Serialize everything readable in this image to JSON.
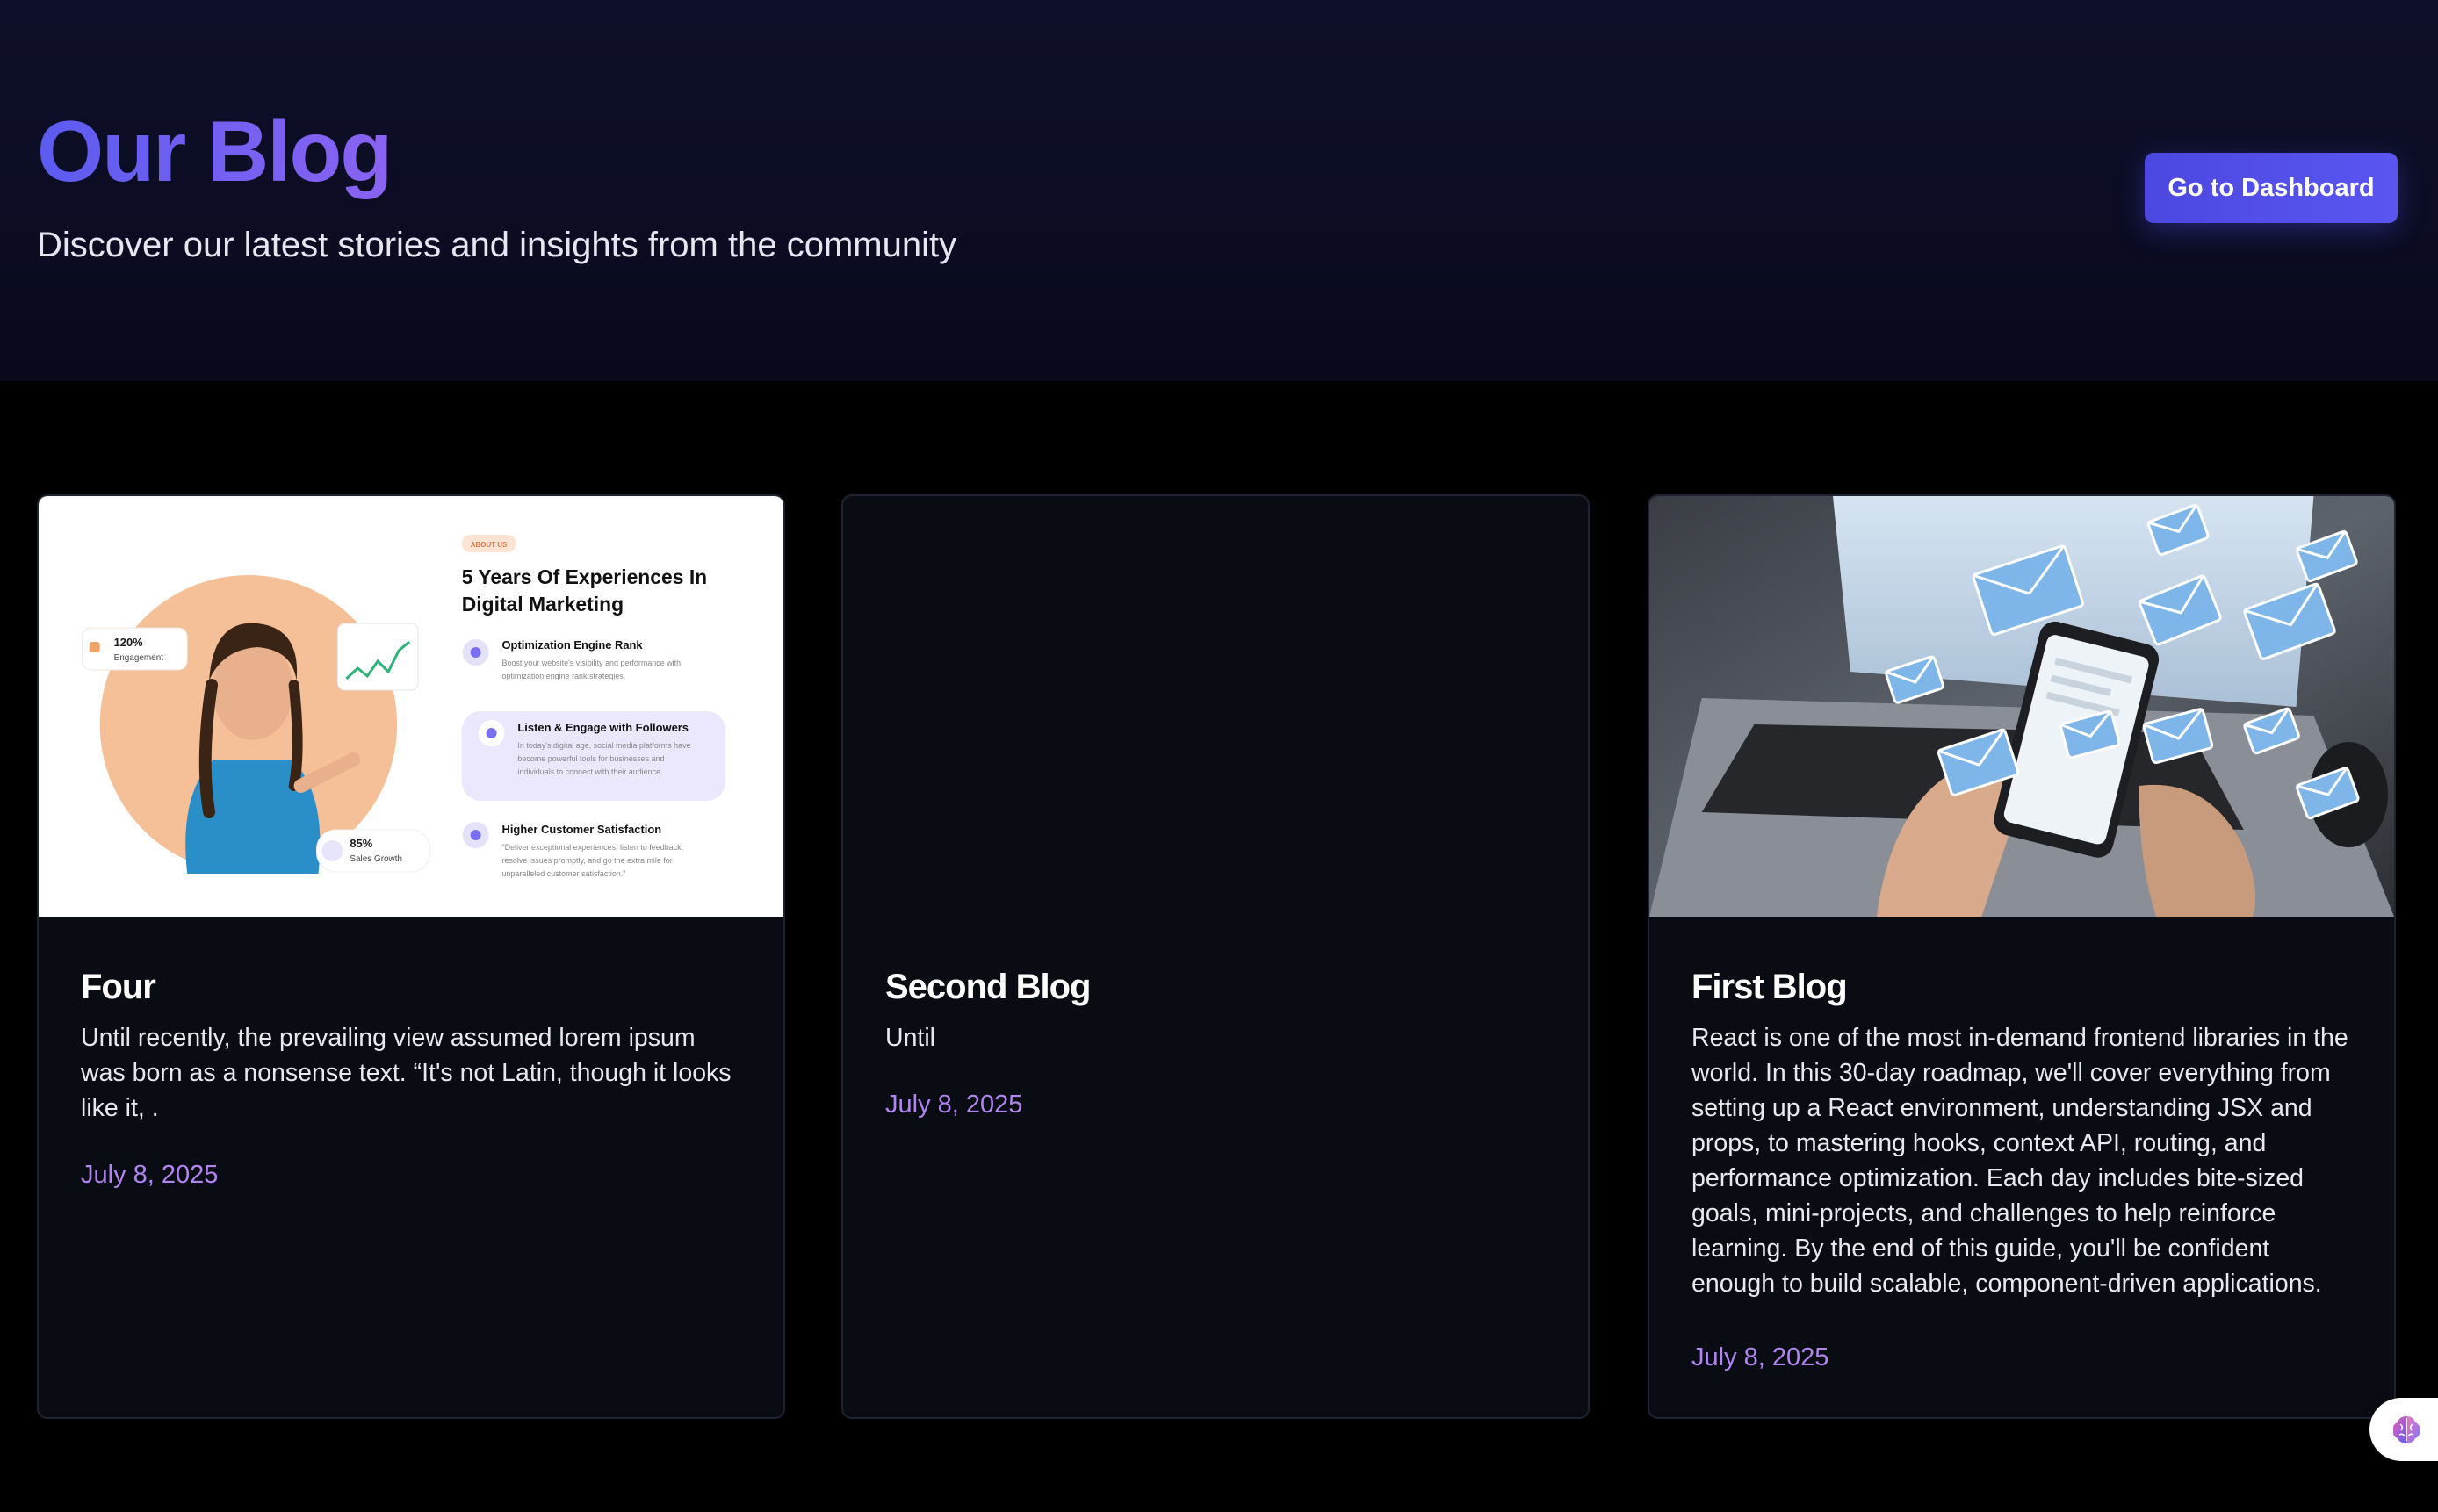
{
  "header": {
    "title": "Our Blog",
    "subtitle": "Discover our latest stories and insights from the community",
    "dashboard_button": "Go to Dashboard"
  },
  "posts": [
    {
      "title": "Four",
      "excerpt": "Until recently, the prevailing view assumed lorem ipsum was born as a nonsense text. “It's not Latin, though it looks like it, .",
      "date": "July 8, 2025",
      "image": {
        "kind": "marketing-banner",
        "tag": "ABOUT US",
        "heading_line1": "5 Years Of Experiences In",
        "heading_line2": "Digital Marketing",
        "engagement_value": "120%",
        "engagement_label": "Engagement",
        "sales_value": "85%",
        "sales_label": "Sales Growth",
        "features": [
          {
            "title": "Optimization Engine Rank",
            "desc_line1": "Boost your website's visibility and performance with",
            "desc_line2": "optimization engine rank strategies.",
            "desc_line3": ""
          },
          {
            "title": "Listen & Engage with Followers",
            "desc_line1": "In today's digital age, social media platforms have",
            "desc_line2": "become powerful tools for businesses and",
            "desc_line3": "individuals to connect with their audience."
          },
          {
            "title": "Higher Customer Satisfaction",
            "desc_line1": "\"Deliver exceptional experiences, listen to feedback,",
            "desc_line2": "resolve issues promptly, and go the extra mile for",
            "desc_line3": "unparalleled customer satisfaction.\""
          }
        ]
      }
    },
    {
      "title": "Second Blog",
      "excerpt": "Until",
      "date": "July 8, 2025",
      "image": null
    },
    {
      "title": "First Blog",
      "excerpt": "React is one of the most in-demand frontend libraries in the world. In this 30-day roadmap, we'll cover everything from setting up a React environment, understanding JSX and props, to mastering hooks, context API, routing, and performance optimization. Each day includes bite-sized goals, mini-projects, and challenges to help reinforce learning. By the end of this guide, you'll be confident enough to build scalable, component-driven applications.",
      "date": "July 8, 2025",
      "image": {
        "kind": "photo-email-phone-laptop"
      }
    }
  ],
  "floating_widget": {
    "icon": "brain-icon"
  },
  "colors": {
    "accent": "#5a55f0",
    "title_gradient_start": "#5b5cf0",
    "title_gradient_end": "#8a63f2",
    "date": "#b184ef",
    "card_bg": "#0a0c14",
    "page_bg": "#000000"
  }
}
